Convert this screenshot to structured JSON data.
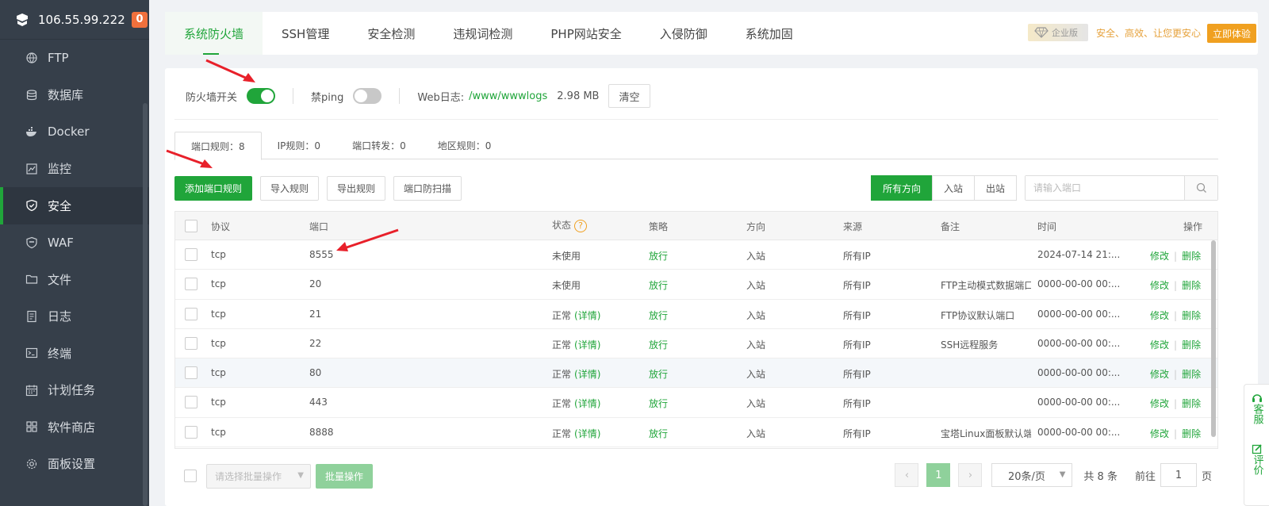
{
  "sidebar": {
    "server_ip": "106.55.99.222",
    "badge_count": "0",
    "items": [
      {
        "label": "FTP",
        "icon": "globe-icon"
      },
      {
        "label": "数据库",
        "icon": "database-icon"
      },
      {
        "label": "Docker",
        "icon": "docker-icon"
      },
      {
        "label": "监控",
        "icon": "monitor-icon"
      },
      {
        "label": "安全",
        "icon": "shield-icon",
        "active": true
      },
      {
        "label": "WAF",
        "icon": "waf-shield-icon"
      },
      {
        "label": "文件",
        "icon": "folder-icon"
      },
      {
        "label": "日志",
        "icon": "log-icon"
      },
      {
        "label": "终端",
        "icon": "terminal-icon"
      },
      {
        "label": "计划任务",
        "icon": "calendar-icon"
      },
      {
        "label": "软件商店",
        "icon": "grid-icon"
      },
      {
        "label": "面板设置",
        "icon": "gear-icon"
      }
    ]
  },
  "top_tabs": [
    "系统防火墙",
    "SSH管理",
    "安全检测",
    "违规词检测",
    "PHP网站安全",
    "入侵防御",
    "系统加固"
  ],
  "promo": {
    "badge": "企业版",
    "text": "安全、高效、让您更安心",
    "button": "立即体验"
  },
  "controls": {
    "firewall_label": "防火墙开关",
    "firewall_on": true,
    "ping_label": "禁ping",
    "ping_on": false,
    "weblog_label": "Web日志:",
    "weblog_path": "/www/wwwlogs",
    "weblog_size": "2.98 MB",
    "clear_button": "清空"
  },
  "sub_tabs": [
    "端口规则：8",
    "IP规则：0",
    "端口转发：0",
    "地区规则：0"
  ],
  "actions": {
    "add": "添加端口规则",
    "import": "导入规则",
    "export": "导出规则",
    "scan": "端口防扫描"
  },
  "direction_filter": [
    "所有方向",
    "入站",
    "出站"
  ],
  "search": {
    "placeholder": "请输入端口"
  },
  "table": {
    "headers": {
      "protocol": "协议",
      "port": "端口",
      "status": "状态",
      "policy": "策略",
      "direction": "方向",
      "source": "来源",
      "remark": "备注",
      "time": "时间",
      "ops": "操作"
    },
    "help_glyph": "?",
    "detail_label": "(详情)",
    "edit_label": "修改",
    "delete_label": "删除",
    "op_separator": "|",
    "rows": [
      {
        "protocol": "tcp",
        "port": "8555",
        "status": "未使用",
        "detail": false,
        "policy": "放行",
        "direction": "入站",
        "source": "所有IP",
        "remark": "",
        "time": "2024-07-14 21:..."
      },
      {
        "protocol": "tcp",
        "port": "20",
        "status": "未使用",
        "detail": false,
        "policy": "放行",
        "direction": "入站",
        "source": "所有IP",
        "remark": "FTP主动模式数据端口",
        "time": "0000-00-00 00:..."
      },
      {
        "protocol": "tcp",
        "port": "21",
        "status": "正常",
        "detail": true,
        "policy": "放行",
        "direction": "入站",
        "source": "所有IP",
        "remark": "FTP协议默认端口",
        "time": "0000-00-00 00:..."
      },
      {
        "protocol": "tcp",
        "port": "22",
        "status": "正常",
        "detail": true,
        "policy": "放行",
        "direction": "入站",
        "source": "所有IP",
        "remark": "SSH远程服务",
        "time": "0000-00-00 00:..."
      },
      {
        "protocol": "tcp",
        "port": "80",
        "status": "正常",
        "detail": true,
        "policy": "放行",
        "direction": "入站",
        "source": "所有IP",
        "remark": "",
        "time": "0000-00-00 00:...",
        "highlight": true
      },
      {
        "protocol": "tcp",
        "port": "443",
        "status": "正常",
        "detail": true,
        "policy": "放行",
        "direction": "入站",
        "source": "所有IP",
        "remark": "",
        "time": "0000-00-00 00:..."
      },
      {
        "protocol": "tcp",
        "port": "8888",
        "status": "正常",
        "detail": true,
        "policy": "放行",
        "direction": "入站",
        "source": "所有IP",
        "remark": "宝塔Linux面板默认端口",
        "time": "0000-00-00 00:..."
      }
    ]
  },
  "footer": {
    "batch_placeholder": "请选择批量操作",
    "batch_button": "批量操作",
    "prev_glyph": "‹",
    "next_glyph": "›",
    "current_page": "1",
    "page_size": "20条/页",
    "total": "共 8 条",
    "goto_label": "前往",
    "goto_value": "1",
    "page_unit": "页"
  },
  "right_float": {
    "service": "客服",
    "review": "评价"
  },
  "colors": {
    "accent": "#20a53a",
    "sidebar_bg": "#363f4a",
    "annotation_arrow": "#e8202a",
    "promo": "#f0a020"
  }
}
